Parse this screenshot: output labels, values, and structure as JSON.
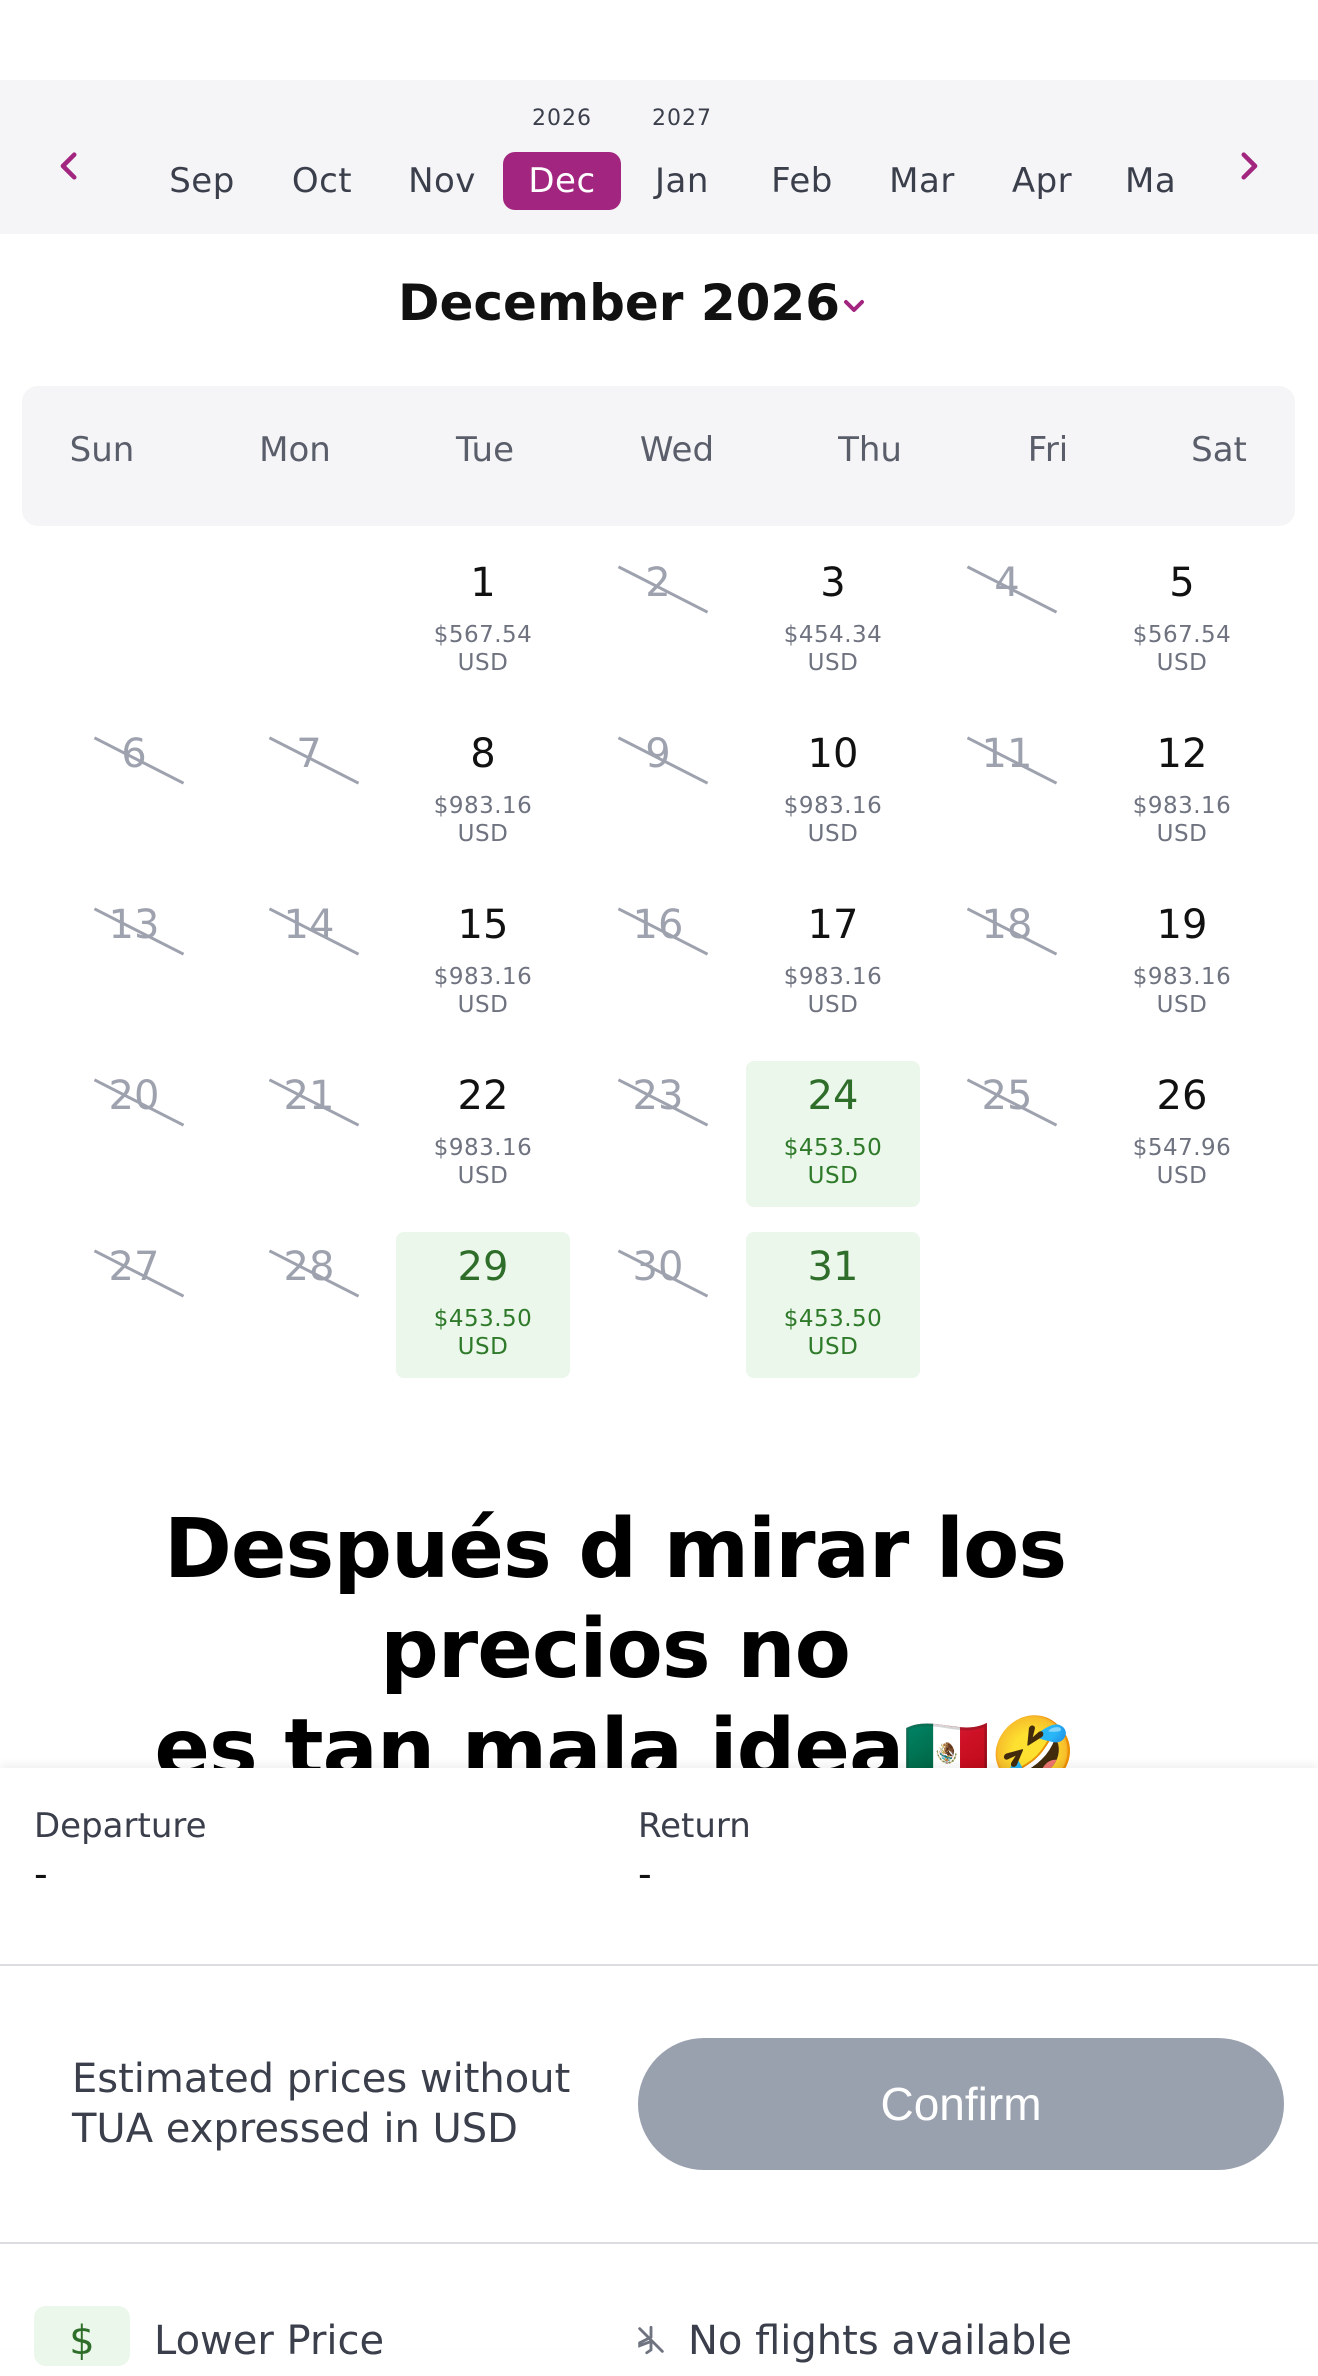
{
  "month_strip": {
    "prev_icon": "chevron-left-icon",
    "next_icon": "chevron-right-icon",
    "years": [
      "2026",
      "2027"
    ],
    "months": [
      "Sep",
      "Oct",
      "Nov",
      "Dec",
      "Jan",
      "Feb",
      "Mar",
      "Apr",
      "Ma"
    ],
    "selected_month": "Dec",
    "accent_color": "#a2267f"
  },
  "calendar": {
    "title": "December 2026",
    "weekdays": [
      "Sun",
      "Mon",
      "Tue",
      "Wed",
      "Thu",
      "Fri",
      "Sat"
    ],
    "weeks": [
      [
        null,
        null,
        {
          "day": "1",
          "price": "$567.54",
          "currency": "USD",
          "status": "available"
        },
        {
          "day": "2",
          "status": "unavailable"
        },
        {
          "day": "3",
          "price": "$454.34",
          "currency": "USD",
          "status": "available"
        },
        {
          "day": "4",
          "status": "unavailable"
        },
        {
          "day": "5",
          "price": "$567.54",
          "currency": "USD",
          "status": "available"
        }
      ],
      [
        {
          "day": "6",
          "status": "unavailable"
        },
        {
          "day": "7",
          "status": "unavailable"
        },
        {
          "day": "8",
          "price": "$983.16",
          "currency": "USD",
          "status": "available"
        },
        {
          "day": "9",
          "status": "unavailable"
        },
        {
          "day": "10",
          "price": "$983.16",
          "currency": "USD",
          "status": "available"
        },
        {
          "day": "11",
          "status": "unavailable"
        },
        {
          "day": "12",
          "price": "$983.16",
          "currency": "USD",
          "status": "available"
        }
      ],
      [
        {
          "day": "13",
          "status": "unavailable"
        },
        {
          "day": "14",
          "status": "unavailable"
        },
        {
          "day": "15",
          "price": "$983.16",
          "currency": "USD",
          "status": "available"
        },
        {
          "day": "16",
          "status": "unavailable"
        },
        {
          "day": "17",
          "price": "$983.16",
          "currency": "USD",
          "status": "available"
        },
        {
          "day": "18",
          "status": "unavailable"
        },
        {
          "day": "19",
          "price": "$983.16",
          "currency": "USD",
          "status": "available"
        }
      ],
      [
        {
          "day": "20",
          "status": "unavailable"
        },
        {
          "day": "21",
          "status": "unavailable"
        },
        {
          "day": "22",
          "price": "$983.16",
          "currency": "USD",
          "status": "available"
        },
        {
          "day": "23",
          "status": "unavailable"
        },
        {
          "day": "24",
          "price": "$453.50",
          "currency": "USD",
          "status": "lowest"
        },
        {
          "day": "25",
          "status": "unavailable"
        },
        {
          "day": "26",
          "price": "$547.96",
          "currency": "USD",
          "status": "available"
        }
      ],
      [
        {
          "day": "27",
          "status": "unavailable"
        },
        {
          "day": "28",
          "status": "unavailable"
        },
        {
          "day": "29",
          "price": "$453.50",
          "currency": "USD",
          "status": "lowest"
        },
        {
          "day": "30",
          "status": "unavailable"
        },
        {
          "day": "31",
          "price": "$453.50",
          "currency": "USD",
          "status": "lowest"
        },
        null,
        null
      ]
    ],
    "lowest_price_color": "#2f7a2a"
  },
  "caption": {
    "line1": "Después d mirar los precios no",
    "line2": "es tan mala idea",
    "emoji": "🇲🇽🤣"
  },
  "selection": {
    "departure_label": "Departure",
    "departure_value": "-",
    "return_label": "Return",
    "return_value": "-"
  },
  "footer": {
    "note": "Estimated prices without TUA expressed in USD",
    "confirm_label": "Confirm"
  },
  "legend": {
    "lower_price_icon": "$",
    "lower_price_label": "Lower Price",
    "no_flights_label": "No flights available"
  }
}
